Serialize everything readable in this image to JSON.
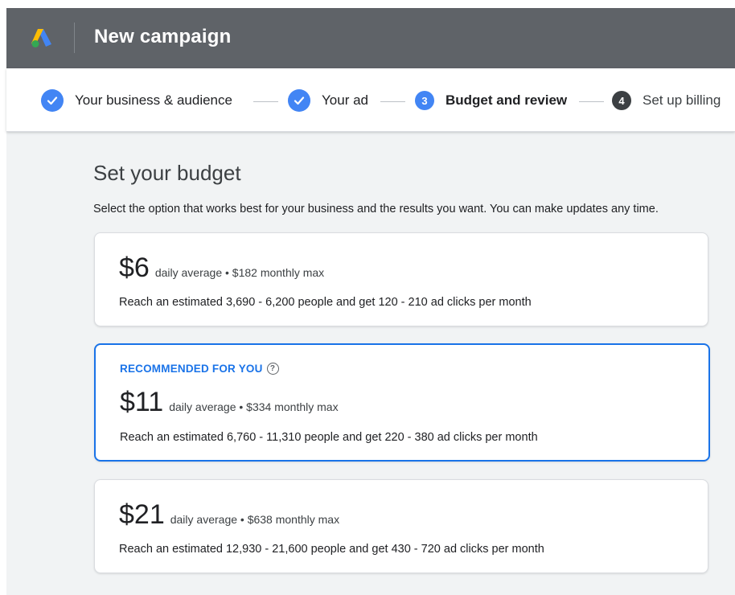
{
  "app": {
    "title": "New campaign"
  },
  "stepper": {
    "steps": [
      {
        "label": "Your business & audience",
        "status": "done",
        "marker": ""
      },
      {
        "label": "Your ad",
        "status": "done",
        "marker": ""
      },
      {
        "label": "Budget and review",
        "status": "active",
        "marker": "3"
      },
      {
        "label": "Set up billing",
        "status": "todo",
        "marker": "4"
      }
    ]
  },
  "budget": {
    "title": "Set your budget",
    "description": "Select the option that works best for your business and the results you want. You can make updates any time.",
    "options": [
      {
        "price": "$6",
        "meta": "daily average • $182 monthly max",
        "reach": "Reach an estimated 3,690 - 6,200 people and get 120 - 210 ad clicks per month",
        "recommended": false
      },
      {
        "badge": "RECOMMENDED FOR YOU",
        "price": "$11",
        "meta": "daily average • $334 monthly max",
        "reach": "Reach an estimated 6,760 - 11,310 people and get 220 - 380 ad clicks per month",
        "recommended": true
      },
      {
        "price": "$21",
        "meta": "daily average • $638 monthly max",
        "reach": "Reach an estimated 12,930 - 21,600 people and get 430 - 720 ad clicks per month",
        "recommended": false
      }
    ]
  },
  "colors": {
    "appbar": "#5f6368",
    "accent": "#1a73e8",
    "step_done": "#4285f4",
    "step_todo": "#3c4043"
  },
  "icons": {
    "logo": "google-ads-logo",
    "check": "check-icon",
    "help": "help-icon"
  }
}
